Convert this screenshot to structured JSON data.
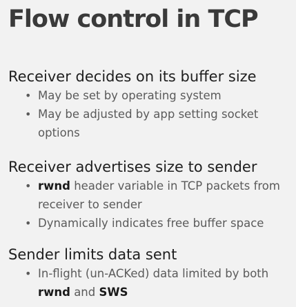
{
  "slide": {
    "title": "Flow control in TCP",
    "bullet_glyph": "•",
    "sections": [
      {
        "heading": "Receiver decides on its buffer size",
        "bullets": [
          {
            "text": "May be set by operating system"
          },
          {
            "text": "May be adjusted by app setting socket options"
          }
        ]
      },
      {
        "heading": "Receiver advertises size to sender",
        "bullets": [
          {
            "bold": "rwnd",
            "text": " header variable in TCP packets from receiver to sender"
          },
          {
            "text": "Dynamically indicates free buffer space"
          }
        ]
      },
      {
        "heading": "Sender limits data sent",
        "bullets": [
          {
            "text": "In-flight (un-ACKed) data limited by both ",
            "bold_a": "rwnd",
            "text_b": " and ",
            "bold_b": "SWS"
          }
        ]
      }
    ]
  }
}
